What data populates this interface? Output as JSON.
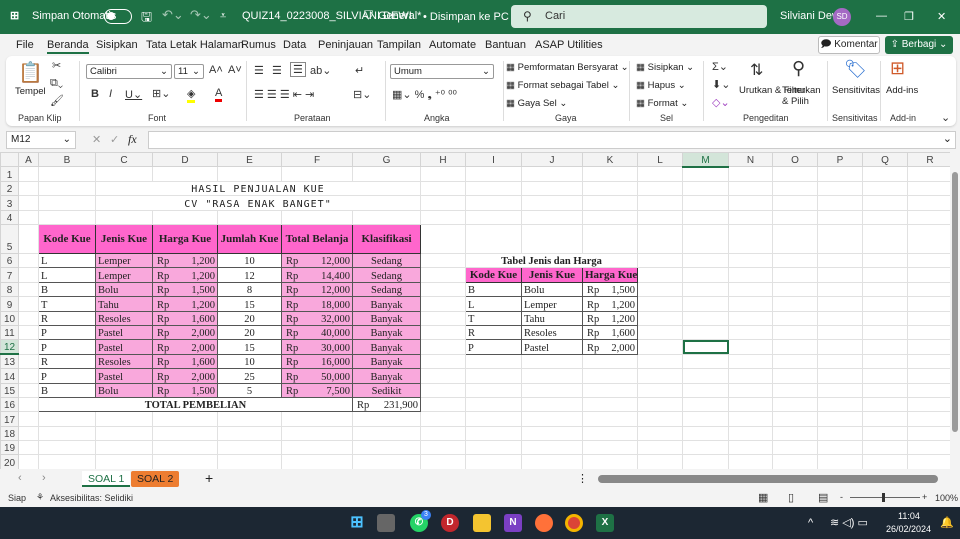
{
  "titlebar": {
    "autosave": "Simpan Otomatis",
    "filename": "QUIZ14_0223008_SILVIANI DEWI",
    "sensitivity": "General*",
    "saved": "• Disimpan ke PC ini ⌄",
    "search_placeholder": "Cari",
    "user": "Silviani Dewi",
    "initials": "SD"
  },
  "menu": {
    "tabs": [
      "File",
      "Beranda",
      "Sisipkan",
      "Tata Letak Halaman",
      "Rumus",
      "Data",
      "Peninjauan",
      "Tampilan",
      "Automate",
      "Bantuan",
      "ASAP Utilities"
    ],
    "active": "Beranda",
    "komentar": "Komentar",
    "berbagi": "Berbagi"
  },
  "ribbon": {
    "paste": "Tempel",
    "font": "Calibri",
    "size": "11",
    "number_format": "Umum",
    "cond_format": "Pemformatan Bersyarat",
    "format_table": "Format sebagai Tabel",
    "cell_styles": "Gaya Sel",
    "insert": "Sisipkan",
    "delete": "Hapus",
    "format": "Format",
    "sort": "Urutkan & Filter",
    "find": "Temukan & Pilih",
    "sensitivity": "Sensitivitas",
    "addins": "Add-ins",
    "groups": [
      "Papan Klip",
      "Font",
      "Perataan",
      "Angka",
      "Gaya",
      "Sel",
      "Pengeditan",
      "Sensitivitas",
      "Add-in"
    ]
  },
  "formula_bar": {
    "name_box": "M12",
    "fx": "fx",
    "value": ""
  },
  "sheet": {
    "columns": [
      "A",
      "B",
      "C",
      "D",
      "E",
      "F",
      "G",
      "H",
      "I",
      "J",
      "K",
      "L",
      "M",
      "N",
      "O",
      "P",
      "Q",
      "R"
    ],
    "selected_cell": "M12",
    "title1": "HASIL PENJUALAN KUE",
    "title2": "CV \"RASA ENAK BANGET\"",
    "main_headers": [
      "Kode Kue",
      "Jenis Kue",
      "Harga Kue",
      "Jumlah Kue",
      "Total Belanja",
      "Klasifikasi"
    ],
    "currency": "Rp",
    "main_rows": [
      [
        "L",
        "Lemper",
        "1,200",
        "10",
        "12,000",
        "Sedang"
      ],
      [
        "L",
        "Lemper",
        "1,200",
        "12",
        "14,400",
        "Sedang"
      ],
      [
        "B",
        "Bolu",
        "1,500",
        "8",
        "12,000",
        "Sedang"
      ],
      [
        "T",
        "Tahu",
        "1,200",
        "15",
        "18,000",
        "Banyak"
      ],
      [
        "R",
        "Resoles",
        "1,600",
        "20",
        "32,000",
        "Banyak"
      ],
      [
        "P",
        "Pastel",
        "2,000",
        "20",
        "40,000",
        "Banyak"
      ],
      [
        "P",
        "Pastel",
        "2,000",
        "15",
        "30,000",
        "Banyak"
      ],
      [
        "R",
        "Resoles",
        "1,600",
        "10",
        "16,000",
        "Banyak"
      ],
      [
        "P",
        "Pastel",
        "2,000",
        "25",
        "50,000",
        "Banyak"
      ],
      [
        "B",
        "Bolu",
        "1,500",
        "5",
        "7,500",
        "Sedikit"
      ]
    ],
    "total_label": "TOTAL PEMBELIAN",
    "total_value": "231,900",
    "ref_title": "Tabel Jenis dan Harga",
    "ref_headers": [
      "Kode Kue",
      "Jenis Kue",
      "Harga Kue"
    ],
    "ref_rows": [
      [
        "B",
        "Bolu",
        "1,500"
      ],
      [
        "L",
        "Lemper",
        "1,200"
      ],
      [
        "T",
        "Tahu",
        "1,200"
      ],
      [
        "R",
        "Resoles",
        "1,600"
      ],
      [
        "P",
        "Pastel",
        "2,000"
      ]
    ]
  },
  "sheet_tabs": [
    "SOAL 1",
    "SOAL 2"
  ],
  "active_tab": "SOAL 1",
  "status": {
    "ready": "Siap",
    "accessibility": "Aksesibilitas: Selidiki",
    "zoom": "100%"
  },
  "taskbar": {
    "time": "11:04",
    "date": "26/02/2024",
    "whatsapp_badge": "3"
  },
  "colors": {
    "brand": "#1e7145",
    "header_pink": "#ff66cc",
    "body_pink": "#f9a8dc",
    "tab2": "#ed7d31"
  }
}
